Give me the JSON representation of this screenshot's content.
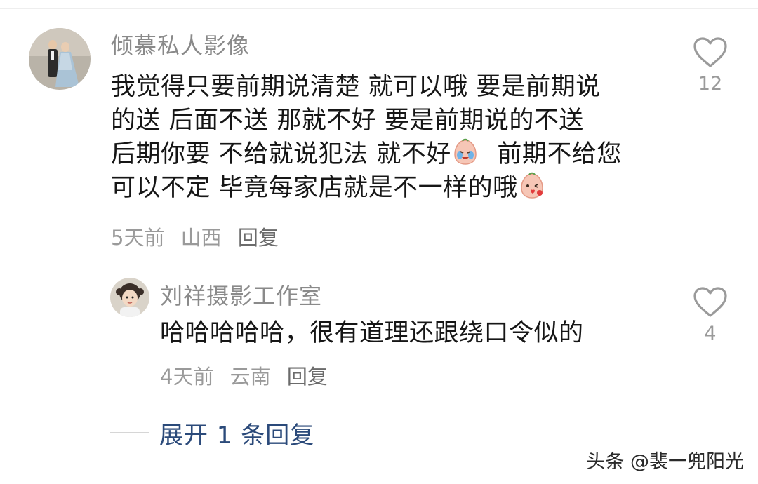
{
  "comments": [
    {
      "author": "倾慕私人影像",
      "lines": [
        "我觉得只要前期说清楚 就可以哦  要是前期说",
        "的送 后面不送 那就不好  要是前期说的不送",
        "后期你要 不给就说犯法 就不好",
        "前期不给您",
        "可以不定 毕竟每家店就是不一样的哦"
      ],
      "time": "5天前",
      "location": "山西",
      "reply_label": "回复",
      "likes": "12"
    },
    {
      "author": "刘祥摄影工作室",
      "lines": [
        "哈哈哈哈哈，很有道理还跟绕口令似的"
      ],
      "time": "4天前",
      "location": "云南",
      "reply_label": "回复",
      "likes": "4"
    }
  ],
  "expand_replies": "展开 1 条回复",
  "watermark": "头条 @裴一兜阳光",
  "icons": {
    "like": "heart-outline-icon",
    "emoji_cry": "crying-face-emoji-icon",
    "emoji_kiss": "kiss-face-emoji-icon"
  },
  "colors": {
    "author": "#8a8a8a",
    "text": "#161616",
    "meta": "#9a9a9a",
    "link": "#2b4a7a"
  }
}
